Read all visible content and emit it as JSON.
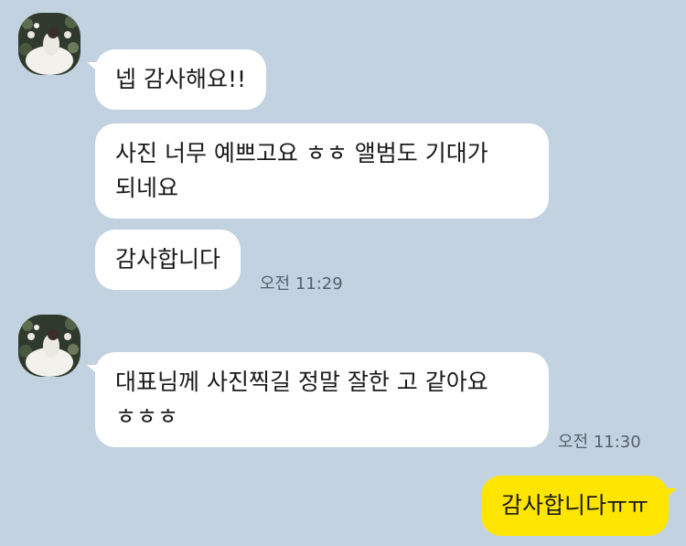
{
  "chat": {
    "group1": {
      "avatar_icon": "profile-photo-icon",
      "messages": [
        "넵 감사해요!!",
        "사진 너무 예쁘고요 ㅎㅎ 앨범도 기대가\n되네요",
        "감사합니다"
      ],
      "time": "오전 11:29"
    },
    "group2": {
      "avatar_icon": "profile-photo-icon",
      "messages": [
        "대표님께 사진찍길 정말 잘한 고 같아요\nㅎㅎㅎ"
      ],
      "time": "오전 11:30"
    },
    "mine": {
      "messages": [
        "감사합니다ㅠㅠ"
      ]
    }
  },
  "colors": {
    "background": "#c3d2e0",
    "incoming_bubble": "#ffffff",
    "outgoing_bubble": "#fee500"
  }
}
